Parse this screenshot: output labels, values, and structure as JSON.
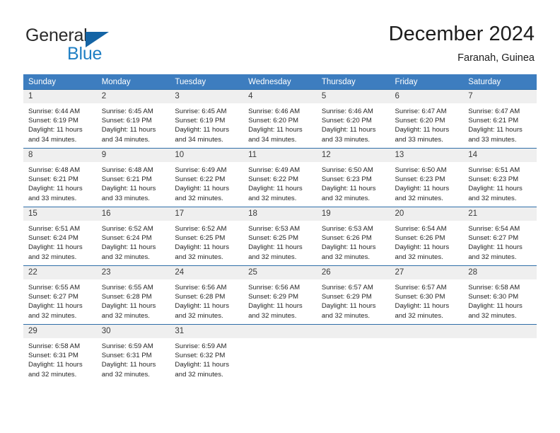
{
  "logo": {
    "text_top": "General",
    "text_bottom": "Blue",
    "triangle_color": "#1464a5",
    "blue_color": "#1f7fc4"
  },
  "header": {
    "title": "December 2024",
    "subtitle": "Faranah, Guinea"
  },
  "theme": {
    "header_band": "#3d7dbf",
    "day_number_band": "#efefef",
    "week_divider": "#2f6ea8"
  },
  "weekday_headers": [
    "Sunday",
    "Monday",
    "Tuesday",
    "Wednesday",
    "Thursday",
    "Friday",
    "Saturday"
  ],
  "labels": {
    "sunrise_prefix": "Sunrise:",
    "sunset_prefix": "Sunset:",
    "daylight_prefix": "Daylight:"
  },
  "weeks": [
    [
      {
        "day": "1",
        "sunrise": "Sunrise: 6:44 AM",
        "sunset": "Sunset: 6:19 PM",
        "daylight_line1": "Daylight: 11 hours",
        "daylight_line2": "and 34 minutes."
      },
      {
        "day": "2",
        "sunrise": "Sunrise: 6:45 AM",
        "sunset": "Sunset: 6:19 PM",
        "daylight_line1": "Daylight: 11 hours",
        "daylight_line2": "and 34 minutes."
      },
      {
        "day": "3",
        "sunrise": "Sunrise: 6:45 AM",
        "sunset": "Sunset: 6:19 PM",
        "daylight_line1": "Daylight: 11 hours",
        "daylight_line2": "and 34 minutes."
      },
      {
        "day": "4",
        "sunrise": "Sunrise: 6:46 AM",
        "sunset": "Sunset: 6:20 PM",
        "daylight_line1": "Daylight: 11 hours",
        "daylight_line2": "and 34 minutes."
      },
      {
        "day": "5",
        "sunrise": "Sunrise: 6:46 AM",
        "sunset": "Sunset: 6:20 PM",
        "daylight_line1": "Daylight: 11 hours",
        "daylight_line2": "and 33 minutes."
      },
      {
        "day": "6",
        "sunrise": "Sunrise: 6:47 AM",
        "sunset": "Sunset: 6:20 PM",
        "daylight_line1": "Daylight: 11 hours",
        "daylight_line2": "and 33 minutes."
      },
      {
        "day": "7",
        "sunrise": "Sunrise: 6:47 AM",
        "sunset": "Sunset: 6:21 PM",
        "daylight_line1": "Daylight: 11 hours",
        "daylight_line2": "and 33 minutes."
      }
    ],
    [
      {
        "day": "8",
        "sunrise": "Sunrise: 6:48 AM",
        "sunset": "Sunset: 6:21 PM",
        "daylight_line1": "Daylight: 11 hours",
        "daylight_line2": "and 33 minutes."
      },
      {
        "day": "9",
        "sunrise": "Sunrise: 6:48 AM",
        "sunset": "Sunset: 6:21 PM",
        "daylight_line1": "Daylight: 11 hours",
        "daylight_line2": "and 33 minutes."
      },
      {
        "day": "10",
        "sunrise": "Sunrise: 6:49 AM",
        "sunset": "Sunset: 6:22 PM",
        "daylight_line1": "Daylight: 11 hours",
        "daylight_line2": "and 32 minutes."
      },
      {
        "day": "11",
        "sunrise": "Sunrise: 6:49 AM",
        "sunset": "Sunset: 6:22 PM",
        "daylight_line1": "Daylight: 11 hours",
        "daylight_line2": "and 32 minutes."
      },
      {
        "day": "12",
        "sunrise": "Sunrise: 6:50 AM",
        "sunset": "Sunset: 6:23 PM",
        "daylight_line1": "Daylight: 11 hours",
        "daylight_line2": "and 32 minutes."
      },
      {
        "day": "13",
        "sunrise": "Sunrise: 6:50 AM",
        "sunset": "Sunset: 6:23 PM",
        "daylight_line1": "Daylight: 11 hours",
        "daylight_line2": "and 32 minutes."
      },
      {
        "day": "14",
        "sunrise": "Sunrise: 6:51 AM",
        "sunset": "Sunset: 6:23 PM",
        "daylight_line1": "Daylight: 11 hours",
        "daylight_line2": "and 32 minutes."
      }
    ],
    [
      {
        "day": "15",
        "sunrise": "Sunrise: 6:51 AM",
        "sunset": "Sunset: 6:24 PM",
        "daylight_line1": "Daylight: 11 hours",
        "daylight_line2": "and 32 minutes."
      },
      {
        "day": "16",
        "sunrise": "Sunrise: 6:52 AM",
        "sunset": "Sunset: 6:24 PM",
        "daylight_line1": "Daylight: 11 hours",
        "daylight_line2": "and 32 minutes."
      },
      {
        "day": "17",
        "sunrise": "Sunrise: 6:52 AM",
        "sunset": "Sunset: 6:25 PM",
        "daylight_line1": "Daylight: 11 hours",
        "daylight_line2": "and 32 minutes."
      },
      {
        "day": "18",
        "sunrise": "Sunrise: 6:53 AM",
        "sunset": "Sunset: 6:25 PM",
        "daylight_line1": "Daylight: 11 hours",
        "daylight_line2": "and 32 minutes."
      },
      {
        "day": "19",
        "sunrise": "Sunrise: 6:53 AM",
        "sunset": "Sunset: 6:26 PM",
        "daylight_line1": "Daylight: 11 hours",
        "daylight_line2": "and 32 minutes."
      },
      {
        "day": "20",
        "sunrise": "Sunrise: 6:54 AM",
        "sunset": "Sunset: 6:26 PM",
        "daylight_line1": "Daylight: 11 hours",
        "daylight_line2": "and 32 minutes."
      },
      {
        "day": "21",
        "sunrise": "Sunrise: 6:54 AM",
        "sunset": "Sunset: 6:27 PM",
        "daylight_line1": "Daylight: 11 hours",
        "daylight_line2": "and 32 minutes."
      }
    ],
    [
      {
        "day": "22",
        "sunrise": "Sunrise: 6:55 AM",
        "sunset": "Sunset: 6:27 PM",
        "daylight_line1": "Daylight: 11 hours",
        "daylight_line2": "and 32 minutes."
      },
      {
        "day": "23",
        "sunrise": "Sunrise: 6:55 AM",
        "sunset": "Sunset: 6:28 PM",
        "daylight_line1": "Daylight: 11 hours",
        "daylight_line2": "and 32 minutes."
      },
      {
        "day": "24",
        "sunrise": "Sunrise: 6:56 AM",
        "sunset": "Sunset: 6:28 PM",
        "daylight_line1": "Daylight: 11 hours",
        "daylight_line2": "and 32 minutes."
      },
      {
        "day": "25",
        "sunrise": "Sunrise: 6:56 AM",
        "sunset": "Sunset: 6:29 PM",
        "daylight_line1": "Daylight: 11 hours",
        "daylight_line2": "and 32 minutes."
      },
      {
        "day": "26",
        "sunrise": "Sunrise: 6:57 AM",
        "sunset": "Sunset: 6:29 PM",
        "daylight_line1": "Daylight: 11 hours",
        "daylight_line2": "and 32 minutes."
      },
      {
        "day": "27",
        "sunrise": "Sunrise: 6:57 AM",
        "sunset": "Sunset: 6:30 PM",
        "daylight_line1": "Daylight: 11 hours",
        "daylight_line2": "and 32 minutes."
      },
      {
        "day": "28",
        "sunrise": "Sunrise: 6:58 AM",
        "sunset": "Sunset: 6:30 PM",
        "daylight_line1": "Daylight: 11 hours",
        "daylight_line2": "and 32 minutes."
      }
    ],
    [
      {
        "day": "29",
        "sunrise": "Sunrise: 6:58 AM",
        "sunset": "Sunset: 6:31 PM",
        "daylight_line1": "Daylight: 11 hours",
        "daylight_line2": "and 32 minutes."
      },
      {
        "day": "30",
        "sunrise": "Sunrise: 6:59 AM",
        "sunset": "Sunset: 6:31 PM",
        "daylight_line1": "Daylight: 11 hours",
        "daylight_line2": "and 32 minutes."
      },
      {
        "day": "31",
        "sunrise": "Sunrise: 6:59 AM",
        "sunset": "Sunset: 6:32 PM",
        "daylight_line1": "Daylight: 11 hours",
        "daylight_line2": "and 32 minutes."
      },
      {
        "day": "",
        "sunrise": "",
        "sunset": "",
        "daylight_line1": "",
        "daylight_line2": ""
      },
      {
        "day": "",
        "sunrise": "",
        "sunset": "",
        "daylight_line1": "",
        "daylight_line2": ""
      },
      {
        "day": "",
        "sunrise": "",
        "sunset": "",
        "daylight_line1": "",
        "daylight_line2": ""
      },
      {
        "day": "",
        "sunrise": "",
        "sunset": "",
        "daylight_line1": "",
        "daylight_line2": ""
      }
    ]
  ]
}
